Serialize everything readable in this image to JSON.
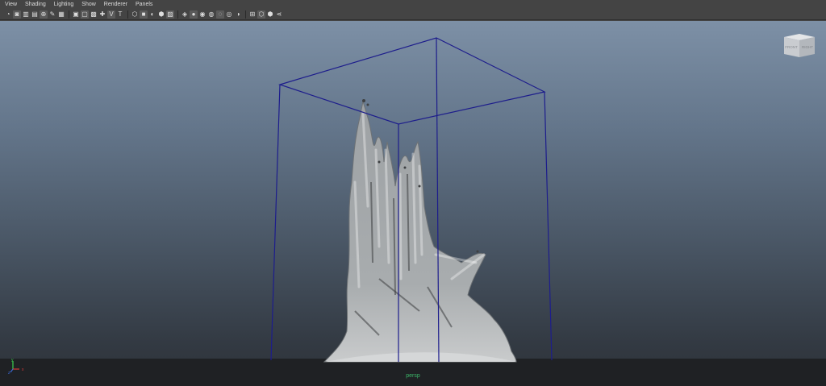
{
  "menu": [
    "View",
    "Shading",
    "Lighting",
    "Show",
    "Renderer",
    "Panels"
  ],
  "toolbar_icons": [
    {
      "name": "select-camera-icon",
      "glyph": "◔"
    },
    {
      "name": "camera-attributes-icon",
      "glyph": "◙"
    },
    {
      "name": "bookmarks-icon",
      "glyph": "▥"
    },
    {
      "name": "image-plane-icon",
      "glyph": "▤"
    },
    {
      "name": "2d-pan-zoom-icon",
      "glyph": "⊕"
    },
    {
      "name": "grease-pencil-icon",
      "glyph": "✎"
    },
    {
      "name": "grid-icon",
      "glyph": "▦"
    },
    {
      "name": "film-gate-icon",
      "glyph": "▣"
    },
    {
      "name": "resolution-gate-icon",
      "glyph": "▢"
    },
    {
      "name": "gate-mask-icon",
      "glyph": "▩"
    },
    {
      "name": "field-chart-icon",
      "glyph": "✚"
    },
    {
      "name": "safe-action-icon",
      "glyph": "V"
    },
    {
      "name": "safe-title-icon",
      "glyph": "T"
    },
    {
      "name": "wireframe-icon",
      "glyph": "⬡"
    },
    {
      "name": "smooth-shade-icon",
      "glyph": "■"
    },
    {
      "name": "default-material-icon",
      "glyph": "◐"
    },
    {
      "name": "wireframe-on-shaded-icon",
      "glyph": "⬢"
    },
    {
      "name": "xray-icon",
      "glyph": "▨"
    },
    {
      "name": "textured-icon",
      "glyph": "◈"
    },
    {
      "name": "use-all-lights-icon",
      "glyph": "●"
    },
    {
      "name": "shadows-icon",
      "glyph": "◉"
    },
    {
      "name": "screen-space-ao-icon",
      "glyph": "◍"
    },
    {
      "name": "motion-blur-icon",
      "glyph": "◌"
    },
    {
      "name": "multisample-aa-icon",
      "glyph": "◎"
    },
    {
      "name": "depth-of-field-icon",
      "glyph": "◑"
    },
    {
      "name": "isolate-select-icon",
      "glyph": "⊞"
    },
    {
      "name": "xray-joints-icon",
      "glyph": "⬡"
    },
    {
      "name": "xray-active-components-icon",
      "glyph": "⬢"
    },
    {
      "name": "node-editor-icon",
      "glyph": "⋖"
    }
  ],
  "viewport": {
    "camera_label": "persp",
    "viewcube": {
      "front_label": "FRONT",
      "right_label": "RIGHT"
    },
    "colors": {
      "bbox": "#1d1d8c",
      "fluid": "#b0b3b5",
      "bg_top": "#7d90a6",
      "bg_bottom": "#2d3238"
    }
  }
}
